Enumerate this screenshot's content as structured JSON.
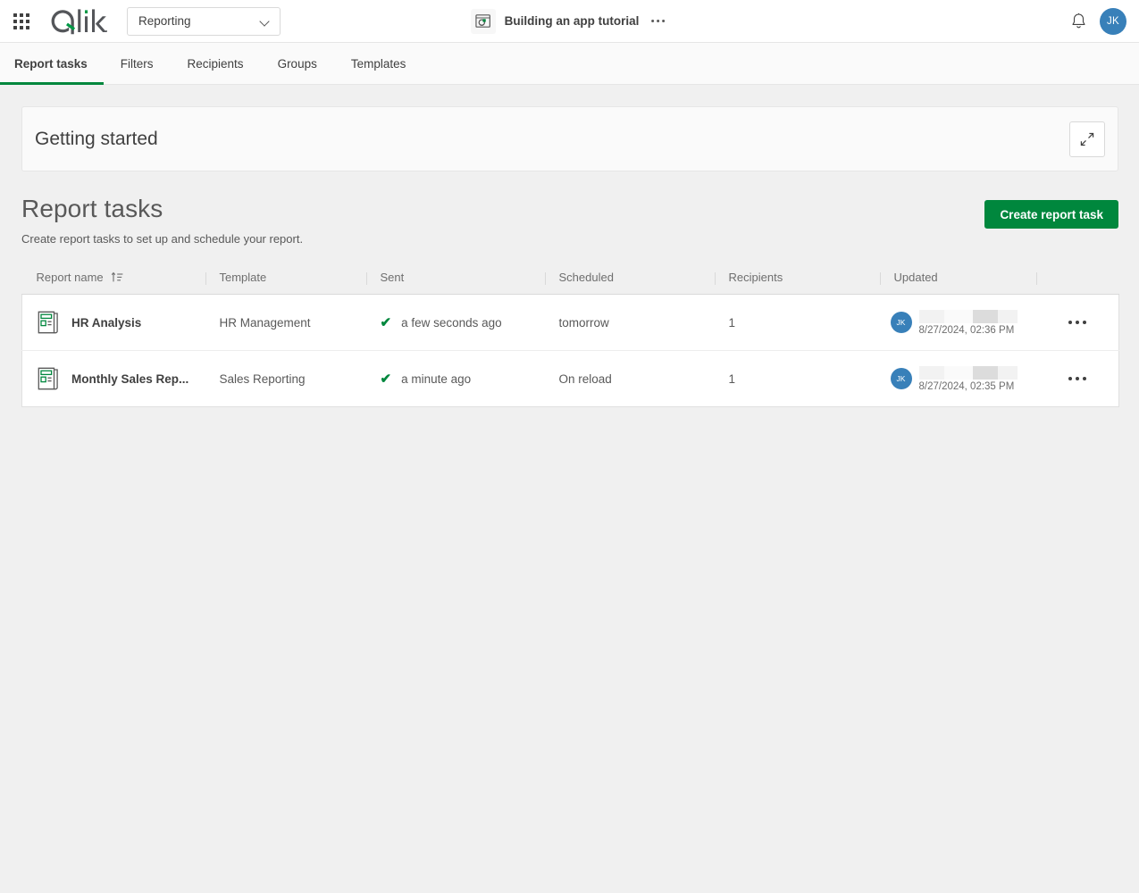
{
  "topbar": {
    "launcher_label": "app-launcher",
    "logo_text": "Qlik",
    "space_selector": {
      "value": "Reporting"
    },
    "app": {
      "title": "Building an app tutorial"
    },
    "avatar_initials": "JK"
  },
  "tabs": [
    {
      "label": "Report tasks",
      "active": true
    },
    {
      "label": "Filters",
      "active": false
    },
    {
      "label": "Recipients",
      "active": false
    },
    {
      "label": "Groups",
      "active": false
    },
    {
      "label": "Templates",
      "active": false
    }
  ],
  "getting_started": {
    "title": "Getting started"
  },
  "section": {
    "title": "Report tasks",
    "subtitle": "Create report tasks to set up and schedule your report.",
    "create_button": "Create report task"
  },
  "table": {
    "columns": [
      {
        "label": "Report name",
        "sort": "ascending"
      },
      {
        "label": "Template"
      },
      {
        "label": "Sent"
      },
      {
        "label": "Scheduled"
      },
      {
        "label": "Recipients"
      },
      {
        "label": "Updated"
      },
      {
        "label": ""
      }
    ],
    "rows": [
      {
        "name": "HR Analysis",
        "template": "HR Management",
        "sent": "a few seconds ago",
        "sent_status": "success",
        "scheduled": "tomorrow",
        "recipients": "1",
        "updated_by_initials": "JK",
        "updated_time": "8/27/2024, 02:36 PM"
      },
      {
        "name": "Monthly Sales Rep...",
        "template": "Sales Reporting",
        "sent": "a minute ago",
        "sent_status": "success",
        "scheduled": "On reload",
        "recipients": "1",
        "updated_by_initials": "JK",
        "updated_time": "8/27/2024, 02:35 PM"
      }
    ]
  },
  "colors": {
    "brand_green": "#00873d",
    "avatar_blue": "#3880b9",
    "page_background": "#f0f0f0",
    "text": "#404040"
  }
}
